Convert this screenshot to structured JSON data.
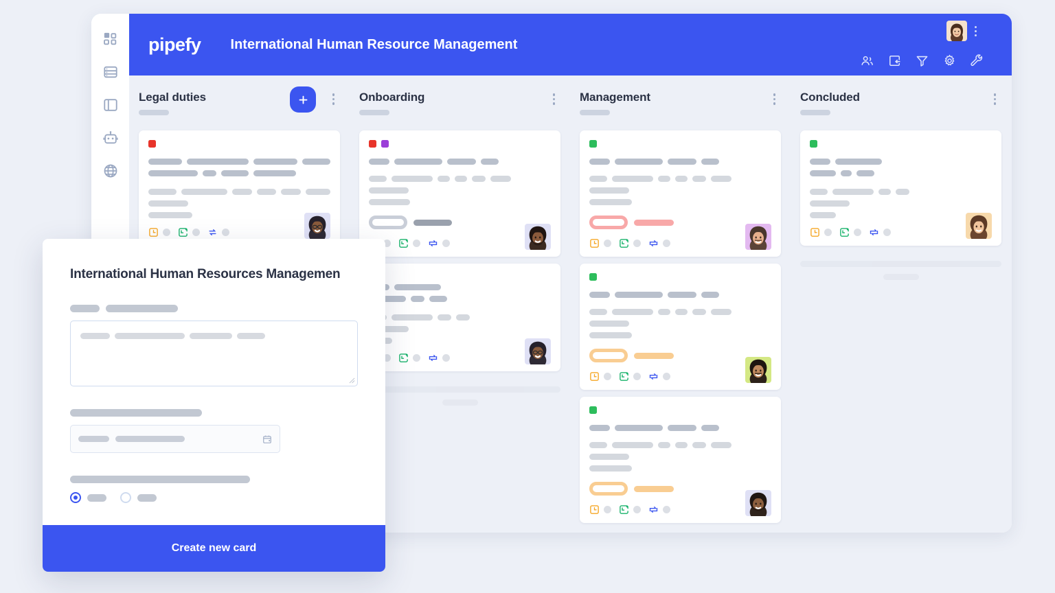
{
  "app": {
    "logo_text": "pipefy",
    "board_title": "International Human Resource Management"
  },
  "sidebar": {
    "items": [
      {
        "icon": "grid-dashboard-icon",
        "label": "Dashboard"
      },
      {
        "icon": "database-icon",
        "label": "Database"
      },
      {
        "icon": "layout-panel-icon",
        "label": "Layout"
      },
      {
        "icon": "robot-icon",
        "label": "Automation"
      },
      {
        "icon": "globe-icon",
        "label": "Portal"
      }
    ]
  },
  "header": {
    "avatar_name": "user-avatar",
    "kebab_label": "more-options",
    "tools": [
      {
        "icon": "members-icon",
        "label": "Members"
      },
      {
        "icon": "inbox-in-icon",
        "label": "Inbox"
      },
      {
        "icon": "filter-icon",
        "label": "Filter"
      },
      {
        "icon": "gear-icon",
        "label": "Settings"
      },
      {
        "icon": "wrench-icon",
        "label": "Tools"
      }
    ]
  },
  "board": {
    "columns": [
      {
        "title": "Legal duties",
        "has_add_button": true,
        "add_label": "+",
        "cards": [
          {
            "chips": [
              "#e8342a"
            ],
            "avatar": "avatar-a",
            "tag": null,
            "foot_icons": [
              "clock-square-icon",
              "calendar-check-icon",
              "connect-arrows-icon"
            ]
          }
        ],
        "ghost_placeholder": false
      },
      {
        "title": "Onboarding",
        "has_add_button": false,
        "cards": [
          {
            "chips": [
              "#e8342a",
              "#9b3fd8"
            ],
            "avatar": "avatar-b",
            "tag": {
              "pill_color": "#c9ced8",
              "bar_color": "#9aa1ad"
            },
            "foot_icons": [
              "clock-square-icon",
              "calendar-check-icon",
              "sync-icon"
            ]
          },
          {
            "chips": [],
            "avatar": "avatar-a",
            "tag": null,
            "foot_icons": [
              "calendar-check-icon",
              "sync-icon"
            ]
          }
        ],
        "ghost_placeholder": true
      },
      {
        "title": "Management",
        "has_add_button": false,
        "cards": [
          {
            "chips": [
              "#2dbd5c"
            ],
            "avatar": "avatar-c",
            "tag": {
              "pill_color": "#f8a8a8",
              "bar_color": "#f8a8a8"
            },
            "foot_icons": [
              "clock-square-icon",
              "calendar-check-icon",
              "sync-icon"
            ]
          },
          {
            "chips": [
              "#2dbd5c"
            ],
            "avatar": "avatar-d",
            "tag": {
              "pill_color": "#f9cd92",
              "bar_color": "#f9cd92"
            },
            "foot_icons": [
              "clock-square-icon",
              "calendar-check-icon",
              "sync-icon"
            ]
          },
          {
            "chips": [
              "#2dbd5c"
            ],
            "avatar": "avatar-e",
            "tag": {
              "pill_color": "#f9cd92",
              "bar_color": "#f9cd92"
            },
            "foot_icons": [
              "clock-square-icon",
              "calendar-check-icon",
              "sync-icon"
            ]
          }
        ],
        "ghost_placeholder": false
      },
      {
        "title": "Concluded",
        "has_add_button": false,
        "cards": [
          {
            "chips": [
              "#2dbd5c"
            ],
            "avatar": "avatar-f",
            "tag": null,
            "short": true,
            "foot_icons": [
              "clock-square-icon",
              "calendar-check-icon",
              "sync-icon"
            ]
          }
        ],
        "ghost_placeholder": true
      }
    ]
  },
  "modal": {
    "title": "International Human Resources Managemen",
    "description_field": {
      "name": "description",
      "placeholder_lines": 1
    },
    "date_field": {
      "name": "due-date",
      "icon": "calendar-icon"
    },
    "radio_group": {
      "name": "options",
      "selected_index": 0,
      "count": 2
    },
    "cta_label": "Create new card"
  },
  "colors": {
    "brand_blue": "#3b55f0",
    "page_bg": "#edf0f7",
    "board_bg": "#edf0f7",
    "text_dark": "#2b3245",
    "skeleton": "#b9c0cc",
    "chip_red": "#e8342a",
    "chip_purple": "#9b3fd8",
    "chip_green": "#2dbd5c",
    "tag_red": "#f8a8a8",
    "tag_orange": "#f9cd92"
  }
}
